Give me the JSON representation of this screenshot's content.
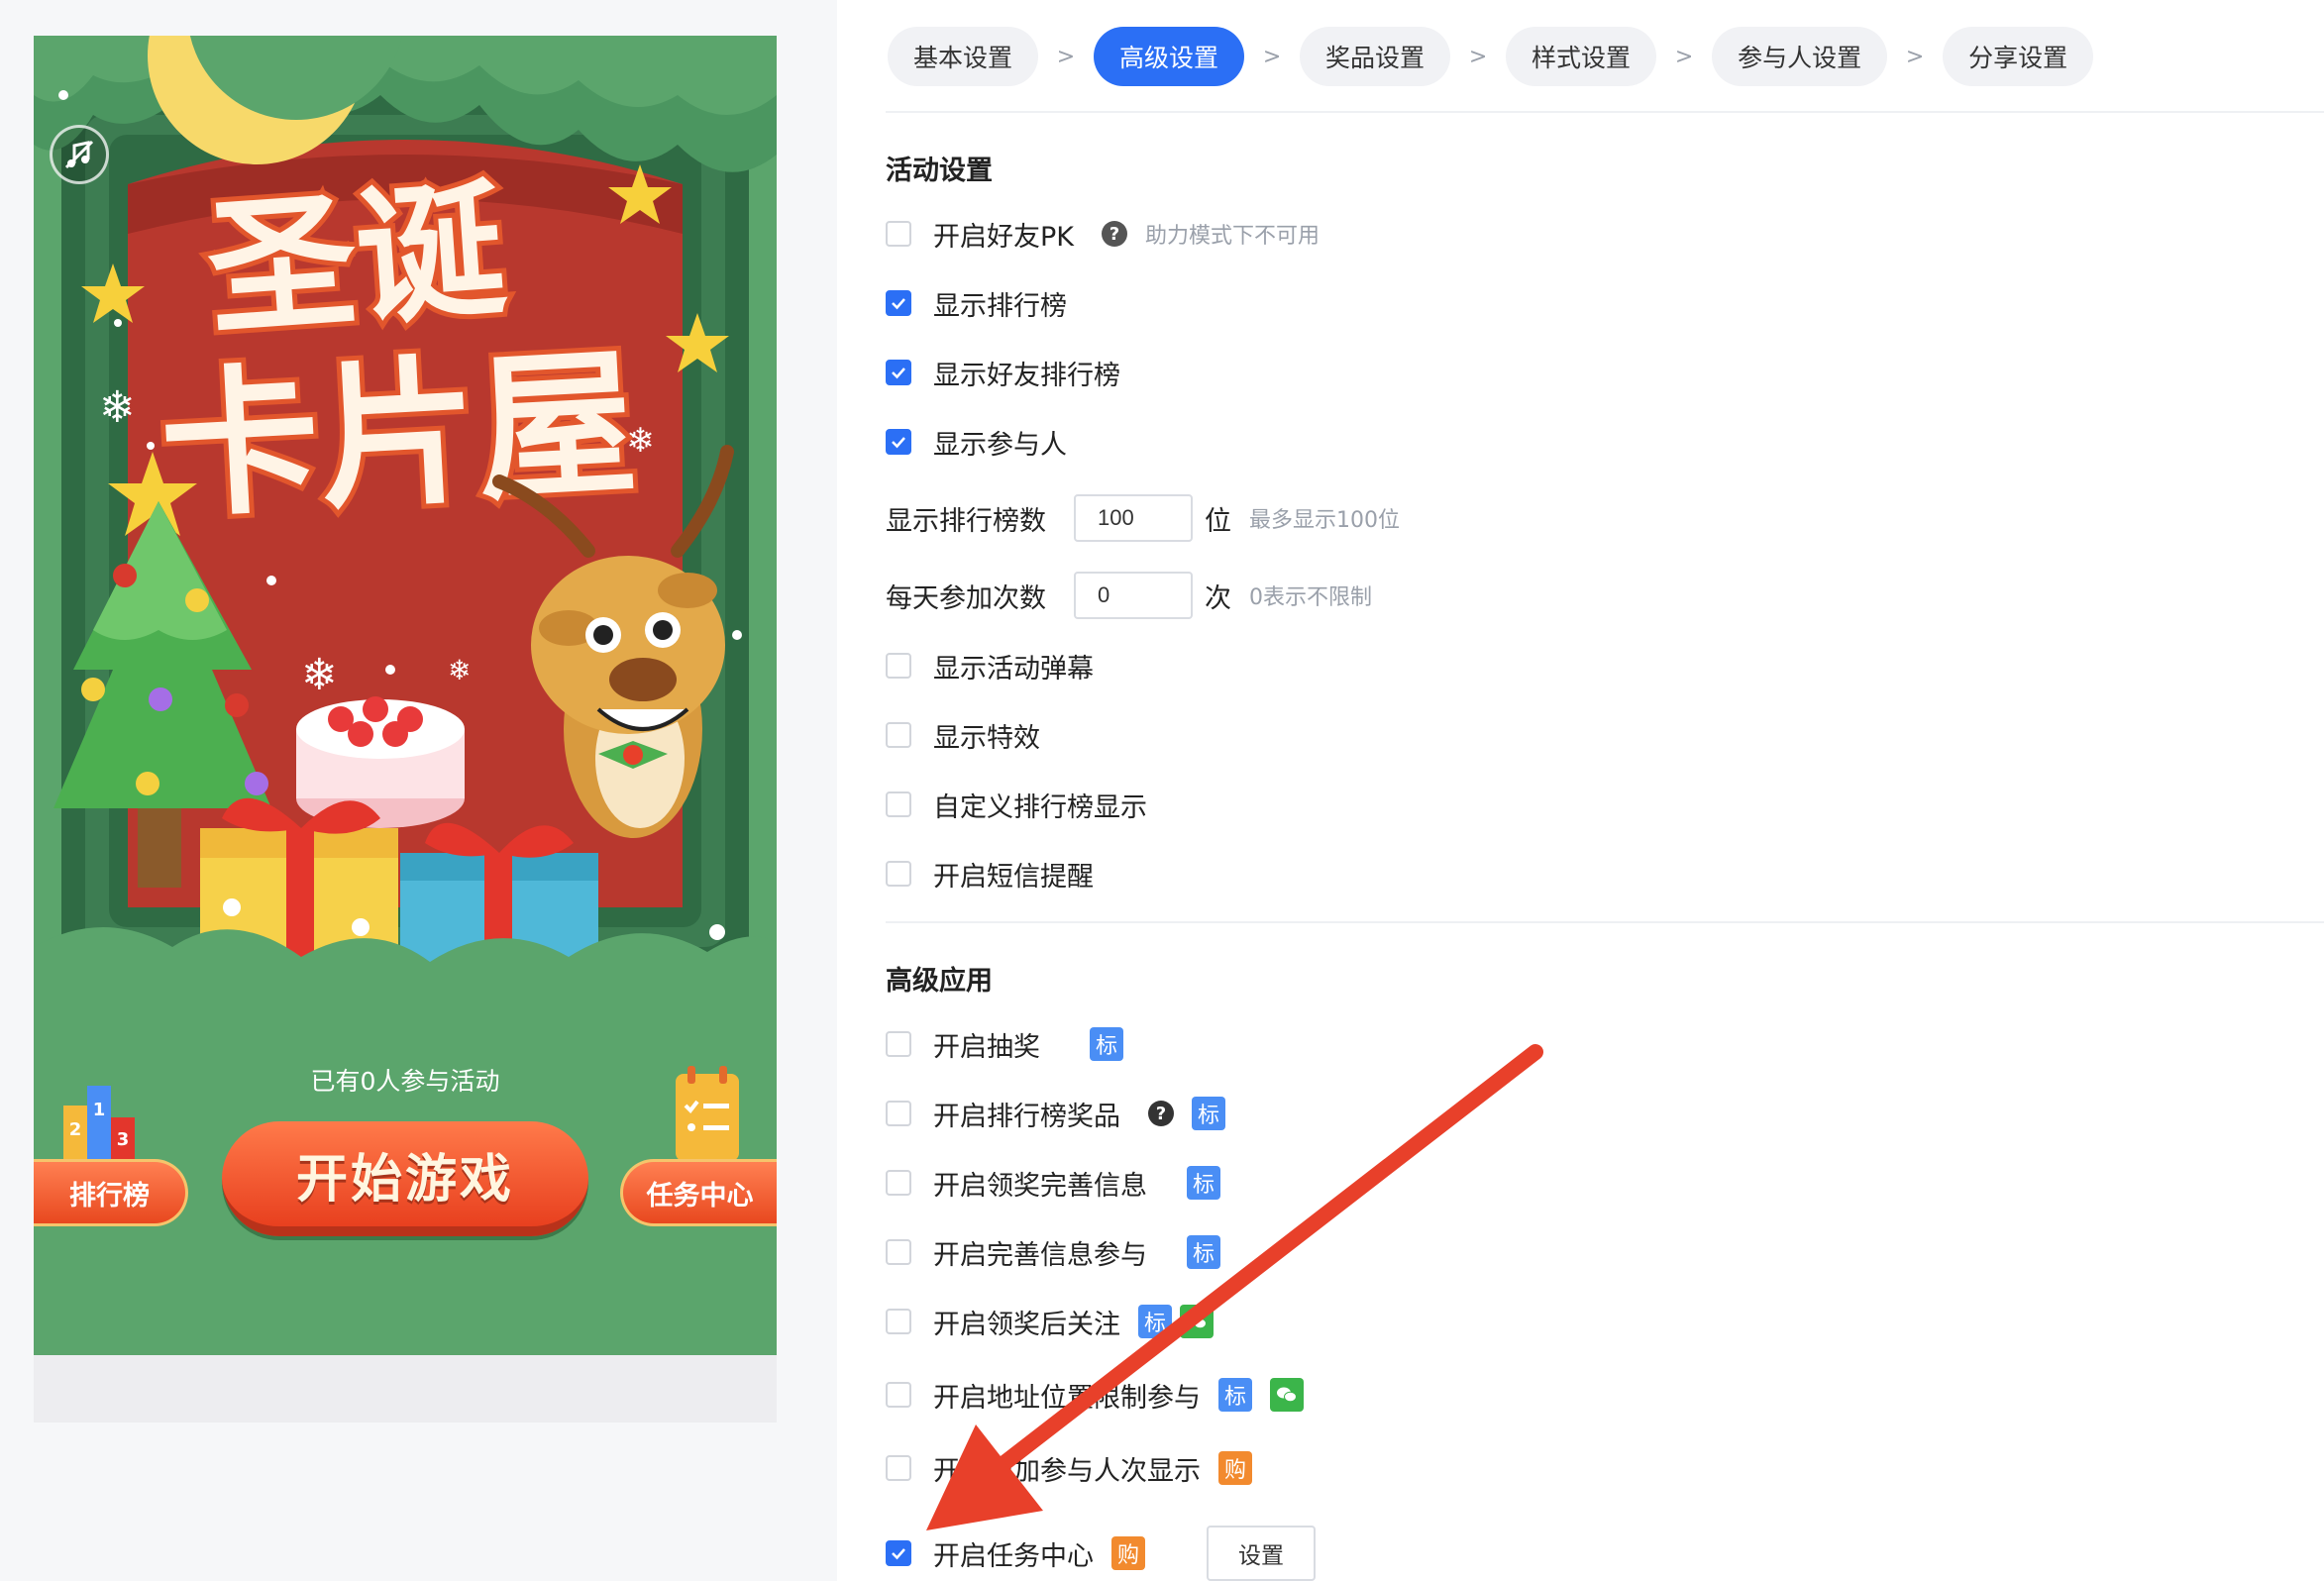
{
  "steps": [
    {
      "label": "基本设置",
      "active": false
    },
    {
      "label": "高级设置",
      "active": true
    },
    {
      "label": "奖品设置",
      "active": false
    },
    {
      "label": "样式设置",
      "active": false
    },
    {
      "label": "参与人设置",
      "active": false
    },
    {
      "label": "分享设置",
      "active": false
    }
  ],
  "step_separator": ">",
  "preview": {
    "title_line1": "圣诞",
    "title_line2": "卡片屋",
    "participants_text": "已有0人参与活动",
    "start_button": "开始游戏",
    "rank_button": "排行榜",
    "task_button": "任务中心",
    "podium_numbers": [
      "2",
      "1",
      "3"
    ],
    "music_icon": "music-off-icon"
  },
  "activity_settings": {
    "title": "活动设置",
    "friend_pk": {
      "label": "开启好友PK",
      "checked": false,
      "hint": "助力模式下不可用"
    },
    "show_ranking": {
      "label": "显示排行榜",
      "checked": true
    },
    "show_friend_ranking": {
      "label": "显示好友排行榜",
      "checked": true
    },
    "show_participants": {
      "label": "显示参与人",
      "checked": true
    },
    "ranking_count": {
      "label": "显示排行榜数",
      "value": "100",
      "unit": "位",
      "hint": "最多显示100位"
    },
    "daily_times": {
      "label": "每天参加次数",
      "value": "0",
      "unit": "次",
      "hint": "0表示不限制"
    },
    "show_barrage": {
      "label": "显示活动弹幕",
      "checked": false
    },
    "show_effects": {
      "label": "显示特效",
      "checked": false
    },
    "custom_ranking": {
      "label": "自定义排行榜显示",
      "checked": false
    },
    "sms_reminder": {
      "label": "开启短信提醒",
      "checked": false
    }
  },
  "advanced_apps": {
    "title": "高级应用",
    "lottery": {
      "label": "开启抽奖",
      "checked": false,
      "tag": "标"
    },
    "ranking_prize": {
      "label": "开启排行榜奖品",
      "checked": false,
      "tag": "标"
    },
    "prize_info": {
      "label": "开启领奖完善信息",
      "checked": false,
      "tag": "标"
    },
    "info_participate": {
      "label": "开启完善信息参与",
      "checked": false,
      "tag": "标"
    },
    "follow_after_prize": {
      "label": "开启领奖后关注",
      "checked": false,
      "tag": "标"
    },
    "location_limit": {
      "label": "开启地址位置限制参与",
      "checked": false,
      "tag": "标"
    },
    "count_display": {
      "label": "开启增加参与人次显示",
      "checked": false,
      "tag": "购"
    },
    "task_center": {
      "label": "开启任务中心",
      "checked": true,
      "tag": "购",
      "button": "设置"
    }
  },
  "colors": {
    "primary": "#2b6ff5",
    "tag_standard": "#4a8ef5",
    "tag_purchase": "#f28a2e",
    "tag_wechat": "#3bb54a",
    "annotation_arrow": "#e8402a",
    "preview_background": "#5ba56c"
  }
}
